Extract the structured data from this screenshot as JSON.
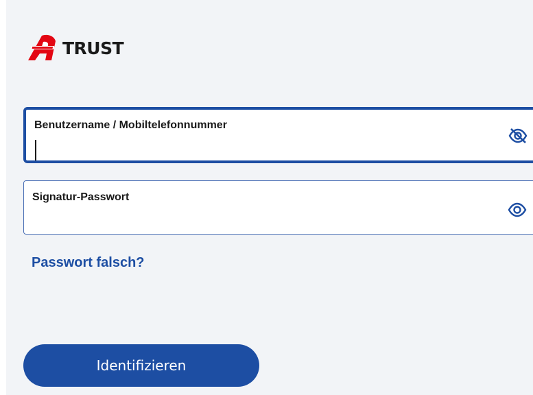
{
  "brand": {
    "name": "TRUST",
    "mark_color": "#e30613"
  },
  "form": {
    "username": {
      "label": "Benutzername / Mobiltelefonnummer",
      "value": "",
      "visibility_icon": "eye-slash-icon"
    },
    "password": {
      "label": "Signatur-Passwort",
      "value": "",
      "visibility_icon": "eye-icon"
    },
    "forgot_link": "Passwort falsch?",
    "submit_label": "Identifizieren"
  },
  "colors": {
    "accent": "#1d4ea3",
    "background": "#f2f4f7"
  }
}
